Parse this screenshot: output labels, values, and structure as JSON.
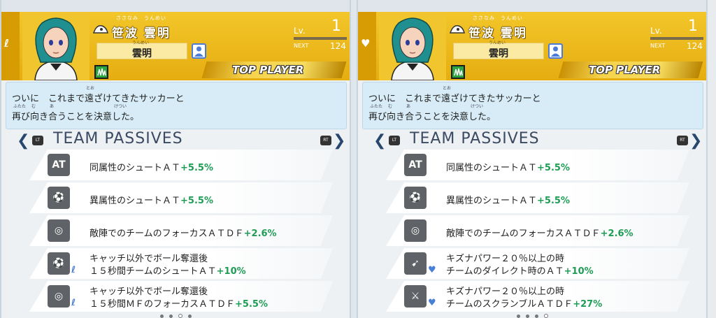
{
  "panels": [
    {
      "side_symbol": "ℓ",
      "player": {
        "full_name": "笹波 雲明",
        "full_name_ruby": "ささなみ　うんめい",
        "nickname": "雲明",
        "nickname_ruby": "うんめい",
        "level_label": "Lv.",
        "level": "1",
        "next_label": "NEXT",
        "next": "124",
        "rank_banner": "TOP PLAYER"
      },
      "quote": {
        "line1": "ついに　これまで遠ざけてきたサッカーと",
        "line2": "再び向き合うことを決意した。",
        "ruby_tooza": "とお",
        "ruby_futata": "ふたた",
        "ruby_mu": "む",
        "ruby_a": "あ",
        "ruby_ketsui": "けつい"
      },
      "section_title": "TEAM PASSIVES",
      "lt_label": "LT",
      "rt_label": "RT",
      "passives": [
        {
          "icon": "at-icon",
          "line1": "同属性のシュートＡＴ",
          "value": "+5.5%",
          "line2": "",
          "kizuna": false
        },
        {
          "icon": "shoot-icon",
          "line1": "異属性のシュートＡＴ",
          "value": "+5.5%",
          "line2": "",
          "kizuna": false
        },
        {
          "icon": "focus-icon",
          "line1": "敵陣でのチームのフォーカスＡＴＤＦ",
          "value": "+2.6%",
          "line2": "",
          "kizuna": false
        },
        {
          "icon": "shoot-icon",
          "line1": "キャッチ以外でボール奪還後",
          "value": "+10%",
          "line2": "１５秒間チームのシュートＡＴ",
          "kizuna": true
        },
        {
          "icon": "focus-icon",
          "line1": "キャッチ以外でボール奪還後",
          "value": "+5.5%",
          "line2": "１５秒間ＭＦのフォーカスＡＴＤＦ",
          "kizuna": true
        }
      ],
      "page_indicator": {
        "total": 4,
        "active": 2
      }
    },
    {
      "side_symbol": "♥",
      "player": {
        "full_name": "笹波 雲明",
        "full_name_ruby": "ささなみ　うんめい",
        "nickname": "雲明",
        "nickname_ruby": "うんめい",
        "level_label": "Lv.",
        "level": "1",
        "next_label": "NEXT",
        "next": "124",
        "rank_banner": "TOP PLAYER"
      },
      "quote": {
        "line1": "ついに　これまで遠ざけてきたサッカーと",
        "line2": "再び向き合うことを決意した。",
        "ruby_tooza": "とお",
        "ruby_futata": "ふたた",
        "ruby_mu": "む",
        "ruby_a": "あ",
        "ruby_ketsui": "けつい"
      },
      "section_title": "TEAM PASSIVES",
      "lt_label": "LT",
      "rt_label": "RT",
      "passives": [
        {
          "icon": "at-icon",
          "line1": "同属性のシュートＡＴ",
          "value": "+5.5%",
          "line2": "",
          "kizuna": false
        },
        {
          "icon": "shoot-icon",
          "line1": "異属性のシュートＡＴ",
          "value": "+5.5%",
          "line2": "",
          "kizuna": false
        },
        {
          "icon": "focus-icon",
          "line1": "敵陣でのチームのフォーカスＡＴＤＦ",
          "value": "+2.6%",
          "line2": "",
          "kizuna": false
        },
        {
          "icon": "direct-icon",
          "line1": "キズナパワー２０％以上の時",
          "value": "+10%",
          "line2": "チームのダイレクト時のＡＴ",
          "kizuna": true
        },
        {
          "icon": "scramble-icon",
          "line1": "キズナパワー２０％以上の時",
          "value": "+27%",
          "line2": "チームのスクランブルＡＴＤＦ",
          "kizuna": true
        }
      ],
      "page_indicator": {
        "total": 4,
        "active": 3
      }
    }
  ],
  "colors": {
    "header_gold": "#e6ad10",
    "positive_green": "#1f9d55",
    "title_navy": "#3a4a63",
    "quote_bg": "#d7ecf6"
  }
}
